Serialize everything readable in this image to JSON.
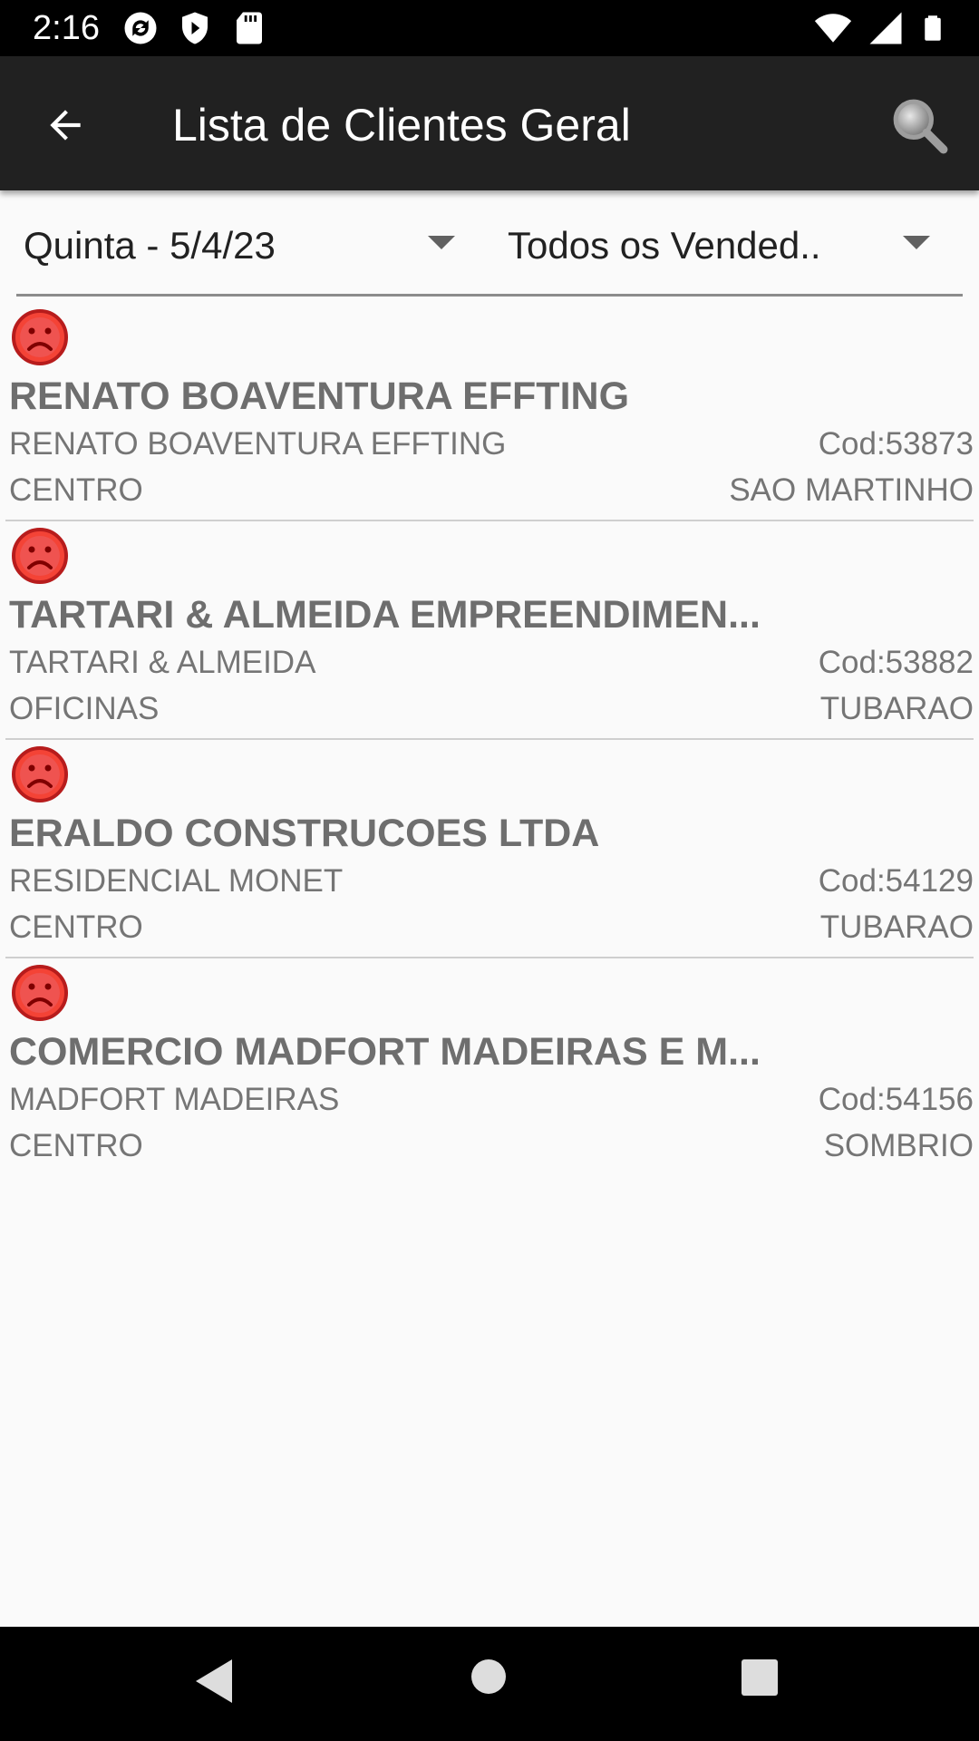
{
  "status_bar": {
    "time": "2:16",
    "left_icons": [
      "sync-icon",
      "shield-icon",
      "sd-card-icon"
    ],
    "right_icons": [
      "wifi-icon",
      "cell-signal-icon",
      "battery-icon"
    ]
  },
  "app_bar": {
    "title": "Lista de Clientes Geral",
    "back_icon": "arrow-back-icon",
    "search_icon": "search-icon",
    "background": "#212121"
  },
  "filters": {
    "day": "Quinta - 5/4/23",
    "seller": "Todos os Vended.."
  },
  "clients": [
    {
      "status_icon": "sad-face-icon",
      "name": "RENATO BOAVENTURA EFFTING",
      "fantasy": "RENATO BOAVENTURA EFFTING",
      "code": "Cod:53873",
      "district": "CENTRO",
      "city": "SAO MARTINHO"
    },
    {
      "status_icon": "sad-face-icon",
      "name": "TARTARI & ALMEIDA EMPREENDIMEN...",
      "fantasy": "TARTARI & ALMEIDA",
      "code": "Cod:53882",
      "district": "OFICINAS",
      "city": "TUBARAO"
    },
    {
      "status_icon": "sad-face-icon",
      "name": "ERALDO CONSTRUCOES LTDA",
      "fantasy": "RESIDENCIAL MONET",
      "code": "Cod:54129",
      "district": "CENTRO",
      "city": "TUBARAO"
    },
    {
      "status_icon": "sad-face-icon",
      "name": "COMERCIO MADFORT MADEIRAS E M...",
      "fantasy": "MADFORT MADEIRAS",
      "code": "Cod:54156",
      "district": "CENTRO",
      "city": "SOMBRIO"
    }
  ],
  "colors": {
    "status_red": "#e53935",
    "name_gray": "#6e6e6e",
    "detail_gray": "#757575"
  }
}
